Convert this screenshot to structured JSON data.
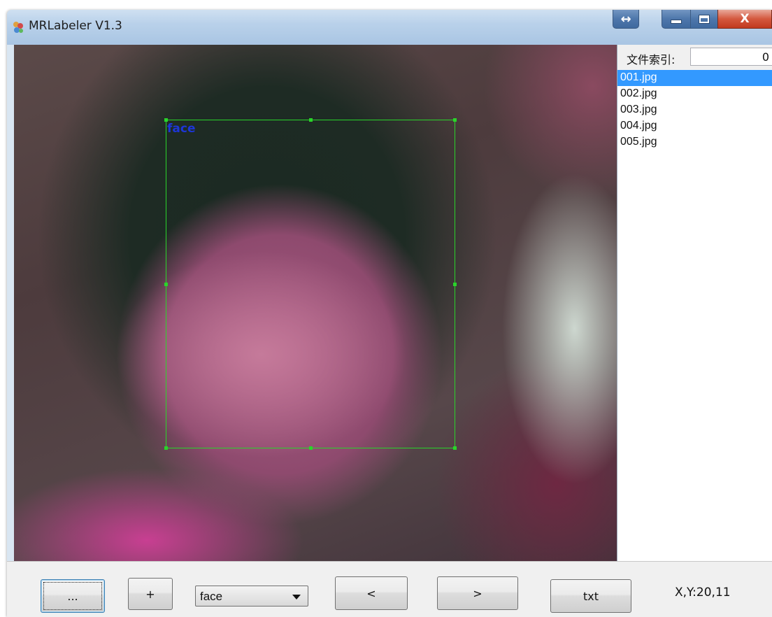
{
  "window": {
    "title": "MRLabeler V1.3",
    "controls": {
      "resize": "↔",
      "close": "X"
    }
  },
  "canvas": {
    "annotation": {
      "label": "face",
      "color": "#2ad42a",
      "label_color": "#1d36d8"
    }
  },
  "sidebar": {
    "index_label": "文件索引:",
    "index_value": "0",
    "files": [
      {
        "name": "001.jpg",
        "selected": true
      },
      {
        "name": "002.jpg",
        "selected": false
      },
      {
        "name": "003.jpg",
        "selected": false
      },
      {
        "name": "004.jpg",
        "selected": false
      },
      {
        "name": "005.jpg",
        "selected": false
      }
    ]
  },
  "toolbar": {
    "open_label": "...",
    "add_label": "+",
    "class_select_value": "face",
    "prev_label": "<",
    "next_label": ">",
    "txt_label": "txt",
    "coords": "X,Y:20,11"
  },
  "colors": {
    "selection": "#3399ff"
  }
}
